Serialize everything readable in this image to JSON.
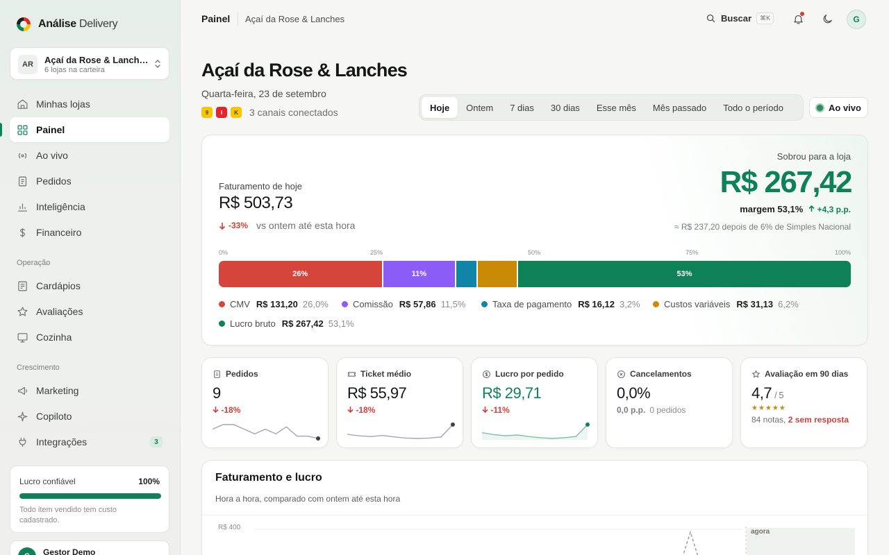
{
  "brand": {
    "name_bold": "Análise",
    "name_light": " Delivery"
  },
  "store_selector": {
    "initials": "AR",
    "name": "Açaí da Rose & Lanches",
    "subtitle": "6 lojas na carteira"
  },
  "sidebar": {
    "items": [
      {
        "label": "Minhas lojas",
        "icon": "store-icon"
      },
      {
        "label": "Painel",
        "icon": "dashboard-icon",
        "active": true
      },
      {
        "label": "Ao vivo",
        "icon": "broadcast-icon"
      },
      {
        "label": "Pedidos",
        "icon": "receipt-icon"
      },
      {
        "label": "Inteligência",
        "icon": "bar-chart-icon"
      },
      {
        "label": "Financeiro",
        "icon": "dollar-icon"
      }
    ],
    "section_operacao": "Operação",
    "operacao_items": [
      {
        "label": "Cardápios",
        "icon": "menu-book-icon"
      },
      {
        "label": "Avaliações",
        "icon": "star-icon"
      },
      {
        "label": "Cozinha",
        "icon": "monitor-icon"
      }
    ],
    "section_crescimento": "Crescimento",
    "crescimento_items": [
      {
        "label": "Marketing",
        "icon": "megaphone-icon"
      },
      {
        "label": "Copiloto",
        "icon": "sparkle-icon"
      },
      {
        "label": "Integrações",
        "icon": "plug-icon",
        "badge": "3"
      }
    ],
    "trust": {
      "label": "Lucro confiável",
      "percent": "100%",
      "fill": 1.0,
      "description": "Todo item vendido tem custo cadastrado."
    },
    "user": {
      "initial": "G",
      "name": "Gestor Demo"
    }
  },
  "topbar": {
    "crumb_root": "Painel",
    "crumb_store": "Açaí da Rose & Lanches",
    "search_label": "Buscar",
    "search_shortcut": "⌘K",
    "avatar_initial": "G"
  },
  "header": {
    "title": "Açaí da Rose & Lanches",
    "date": "Quarta-feira, 23 de setembro",
    "channels": [
      {
        "letter": "9",
        "bg": "#f7c600",
        "fg": "#5a4300"
      },
      {
        "letter": "I",
        "bg": "#e5252e",
        "fg": "#ffffff"
      },
      {
        "letter": "K",
        "bg": "#f7c600",
        "fg": "#5a4300"
      }
    ],
    "channels_label": "3 canais conectados",
    "periods": [
      "Hoje",
      "Ontem",
      "7 dias",
      "30 dias",
      "Esse mês",
      "Mês passado",
      "Todo o período"
    ],
    "selected_period": "Hoje",
    "live_label": "Ao vivo"
  },
  "summary": {
    "revenue_label": "Faturamento de hoje",
    "revenue_value": "R$ 503,73",
    "revenue_delta": "-33%",
    "revenue_delta_context": "vs ontem até esta hora",
    "profit_label": "Sobrou para a loja",
    "profit_value": "R$ 267,42",
    "margin_label": "margem 53,1%",
    "margin_delta": "+4,3 p.p.",
    "after_tax_note": "≈ R$ 237,20 depois de 6% de Simples Nacional",
    "ticks": [
      "0%",
      "25%",
      "50%",
      "75%",
      "100%"
    ],
    "breakdown": [
      {
        "name": "CMV",
        "amount": "R$ 131,20",
        "percent_label": "26,0%",
        "bar_label": "26%",
        "share": 26.0,
        "color": "#d6453c"
      },
      {
        "name": "Comissão",
        "amount": "R$ 57,86",
        "percent_label": "11,5%",
        "bar_label": "11%",
        "share": 11.5,
        "color": "#8b5cf6"
      },
      {
        "name": "Taxa de pagamento",
        "amount": "R$ 16,12",
        "percent_label": "3,2%",
        "bar_label": "",
        "share": 3.2,
        "color": "#0f86a8"
      },
      {
        "name": "Custos variáveis",
        "amount": "R$ 31,13",
        "percent_label": "6,2%",
        "bar_label": "",
        "share": 6.2,
        "color": "#c98a06"
      },
      {
        "name": "Lucro bruto",
        "amount": "R$ 267,42",
        "percent_label": "53,1%",
        "bar_label": "53%",
        "share": 53.1,
        "color": "#0e8159"
      }
    ]
  },
  "kpis": {
    "pedidos": {
      "label": "Pedidos",
      "value": "9",
      "delta": "-18%",
      "spark": [
        4,
        6,
        6,
        4,
        2,
        4,
        2,
        5,
        1,
        1,
        0
      ]
    },
    "ticket": {
      "label": "Ticket médio",
      "value": "R$ 55,97",
      "delta": "-18%",
      "spark": [
        2,
        1.6,
        1.4,
        1.7,
        1.3,
        1.0,
        0.9,
        1.0,
        1.3,
        4.6
      ]
    },
    "lucro_pedido": {
      "label": "Lucro por pedido",
      "value": "R$ 29,71",
      "delta": "-11%",
      "spark": [
        2.3,
        1.8,
        1.5,
        1.7,
        1.3,
        1.0,
        0.8,
        1.0,
        1.3,
        4.4
      ]
    },
    "cancelamentos": {
      "label": "Cancelamentos",
      "value": "0,0%",
      "sub_bold": "0,0 p.p.",
      "sub": "0 pedidos"
    },
    "avaliacao": {
      "label": "Avaliação em 90 dias",
      "value": "4,7",
      "scale": "/ 5",
      "stars": "★★★★★",
      "count": "84 notas,",
      "pending": "2 sem resposta"
    }
  },
  "chart": {
    "title": "Faturamento e lucro",
    "subtitle": "Hora a hora, comparado com ontem até esta hora",
    "y_tick": "R$ 400",
    "now_label": "agora"
  },
  "colors": {
    "accent": "#0e8159",
    "negative": "#d0403a"
  }
}
